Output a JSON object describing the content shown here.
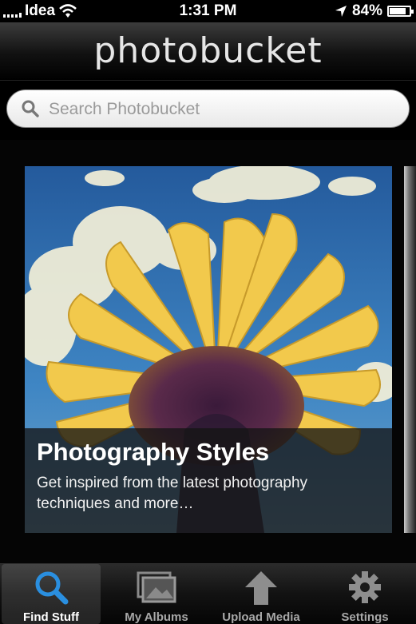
{
  "status_bar": {
    "carrier": "Idea",
    "time": "1:31 PM",
    "battery": "84%",
    "battery_level": 0.84
  },
  "header": {
    "logo_text": "photobucket"
  },
  "search": {
    "placeholder": "Search Photobucket"
  },
  "featured": {
    "title": "Photography Styles",
    "description": "Get inspired from the latest photography techniques and more…"
  },
  "tabs": [
    {
      "label": "Find Stuff",
      "icon": "magnifier-icon",
      "active": true
    },
    {
      "label": "My Albums",
      "icon": "photo-albums-icon",
      "active": false
    },
    {
      "label": "Upload Media",
      "icon": "upload-arrow-icon",
      "active": false
    },
    {
      "label": "Settings",
      "icon": "gear-icon",
      "active": false
    }
  ],
  "colors": {
    "accent_blue": "#2a8fe0",
    "sky": "#2f6fb3",
    "petal": "#f2c94c"
  }
}
